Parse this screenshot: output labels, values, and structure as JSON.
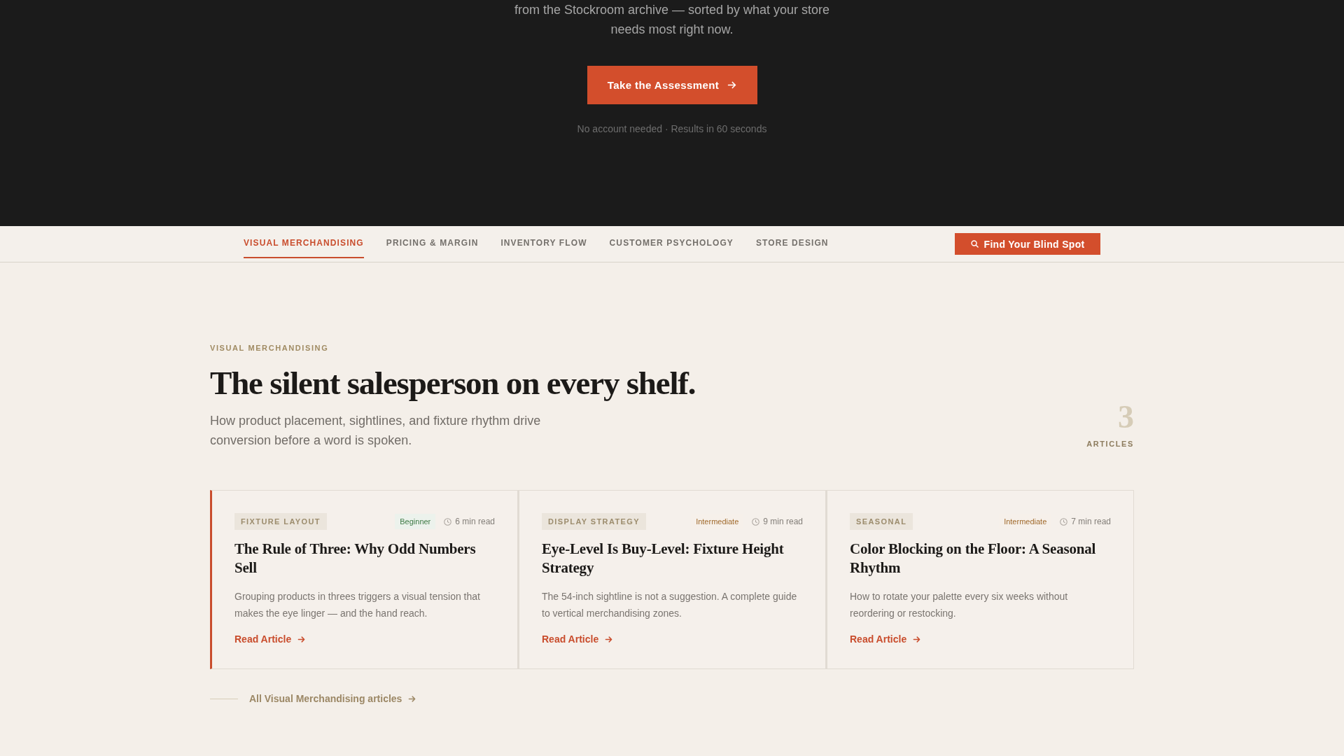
{
  "hero": {
    "intro": "from the Stockroom archive — sorted by what your store needs most right now.",
    "cta_button": {
      "label": "Take the Assessment"
    },
    "note": "No account needed · Results in 60 seconds"
  },
  "category_nav": {
    "tabs": [
      {
        "label": "VISUAL MERCHANDISING",
        "selected": true
      },
      {
        "label": "PRICING & MARGIN",
        "selected": false
      },
      {
        "label": "INVENTORY FLOW",
        "selected": false
      },
      {
        "label": "CUSTOMER PSYCHOLOGY",
        "selected": false
      },
      {
        "label": "STORE DESIGN",
        "selected": false
      }
    ],
    "action_button": {
      "label": "Find Your Blind Spot"
    }
  },
  "section": {
    "eyebrow": "VISUAL MERCHANDISING",
    "heading": "The silent salesperson on every shelf.",
    "subtitle": "How product placement, sightlines, and fixture rhythm drive conversion before a word is spoken.",
    "count": "3",
    "count_label": "ARTICLES"
  },
  "articles": [
    {
      "category": "FIXTURE LAYOUT",
      "difficulty": {
        "label": "Beginner",
        "color": "#3d7a45"
      },
      "read_time": "6 min read",
      "title": "The Rule of Three: Why Odd Numbers Sell",
      "summary": "Grouping products in threes triggers a visual tension that makes the eye linger — and the hand reach.",
      "link": "Read Article",
      "featured": true
    },
    {
      "category": "DISPLAY STRATEGY",
      "difficulty": {
        "label": "Intermediate",
        "color": "#a06a2c"
      },
      "read_time": "9 min read",
      "title": "Eye-Level Is Buy-Level: Fixture Height Strategy",
      "summary": "The 54-inch sightline is not a suggestion. A complete guide to vertical merchandising zones.",
      "link": "Read Article",
      "featured": false
    },
    {
      "category": "SEASONAL",
      "difficulty": {
        "label": "Intermediate",
        "color": "#a06a2c"
      },
      "read_time": "7 min read",
      "title": "Color Blocking on the Floor: A Seasonal Rhythm",
      "summary": "How to rotate your palette every six weeks without reordering or restocking.",
      "link": "Read Article",
      "featured": false
    }
  ],
  "footer_link": {
    "label": "All Visual Merchandising articles"
  }
}
